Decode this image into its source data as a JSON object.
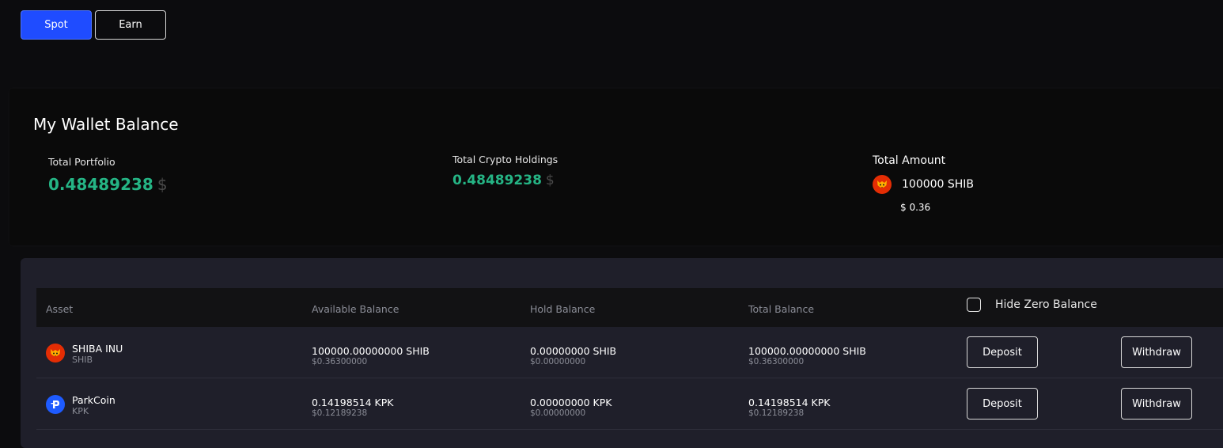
{
  "tabs": [
    {
      "label": "Spot",
      "active": true
    },
    {
      "label": "Earn",
      "active": false
    }
  ],
  "wallet": {
    "title": "My Wallet Balance",
    "total_portfolio_label": "Total Portfolio",
    "total_portfolio_value": "0.48489238",
    "total_crypto_label": "Total Crypto Holdings",
    "total_crypto_value": "0.48489238",
    "currency_symbol": "$",
    "total_amount_label": "Total Amount",
    "total_amount_coin_icon": "shiba-inu-icon",
    "total_amount_value": "100000 SHIB",
    "total_amount_usd": "$ 0.36"
  },
  "table": {
    "headers": [
      "Asset",
      "Available Balance",
      "Hold Balance",
      "Total Balance"
    ],
    "hide_zero_label": "Hide Zero Balance",
    "hide_zero_checked": false,
    "rows": [
      {
        "icon": "shiba-inu-icon",
        "name": "SHIBA INU",
        "symbol": "SHIB",
        "available": "100000.00000000 SHIB",
        "available_usd": "$0.36300000",
        "hold": "0.00000000 SHIB",
        "hold_usd": "$0.00000000",
        "total": "100000.00000000 SHIB",
        "total_usd": "$0.36300000",
        "deposit_label": "Deposit",
        "withdraw_label": "Withdraw"
      },
      {
        "icon": "parkcoin-icon",
        "name": "ParkCoin",
        "symbol": "KPK",
        "available": "0.14198514 KPK",
        "available_usd": "$0.12189238",
        "hold": "0.00000000 KPK",
        "hold_usd": "$0.00000000",
        "total": "0.14198514 KPK",
        "total_usd": "$0.12189238",
        "deposit_label": "Deposit",
        "withdraw_label": "Withdraw"
      }
    ]
  },
  "colors": {
    "accent": "#1f4cff",
    "positive": "#25b585",
    "background": "#0c0c0e",
    "card": "#1f1f2a"
  }
}
